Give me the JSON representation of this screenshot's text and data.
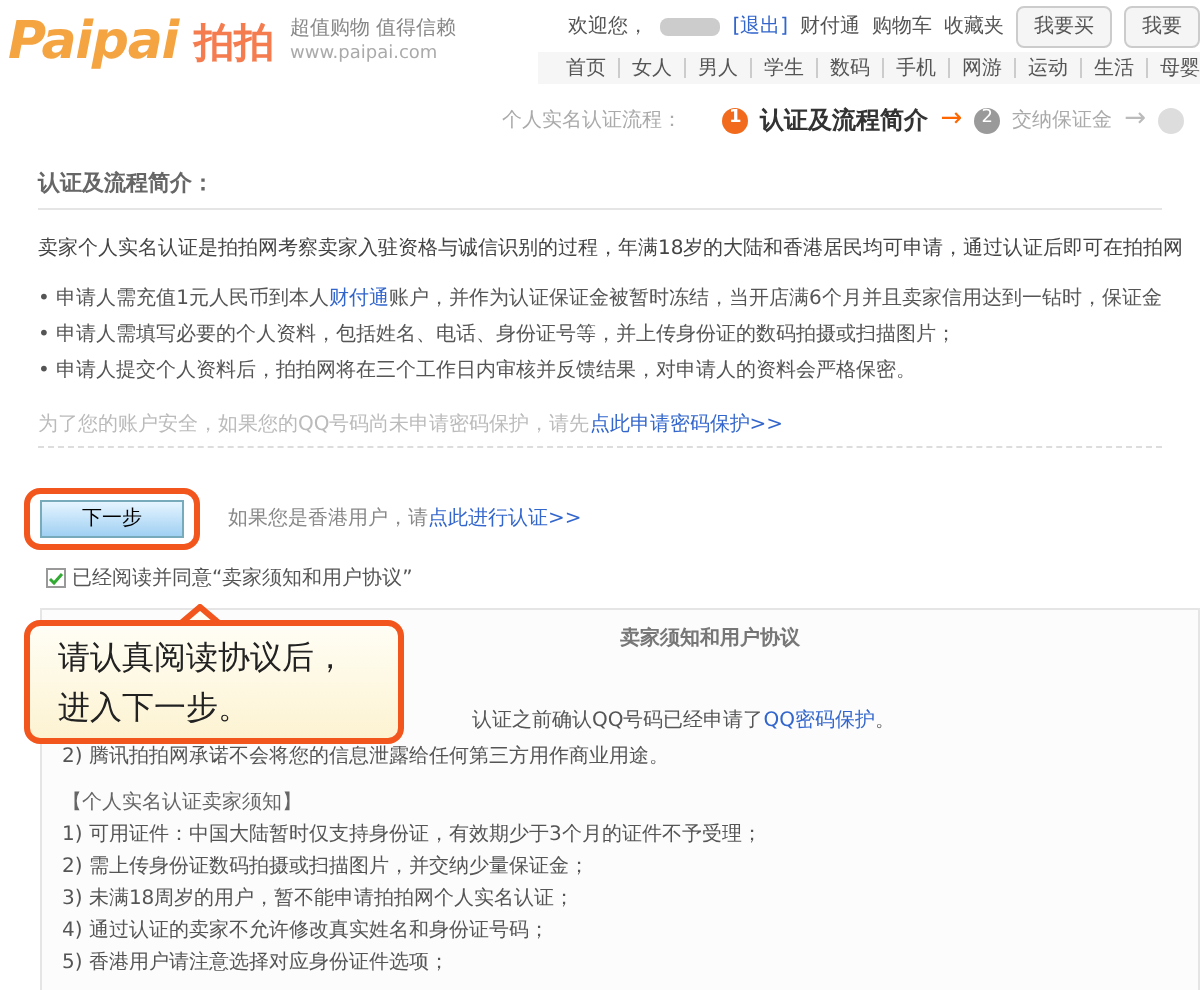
{
  "header": {
    "logo": "Paipai",
    "logo_cn": "拍拍",
    "slogan": "超值购物 值得信赖",
    "url": "www.paipai.com",
    "welcome": "欢迎您，",
    "logout": "[退出]",
    "links": [
      "财付通",
      "购物车",
      "收藏夹"
    ],
    "buttons": [
      "我要买",
      "我要"
    ]
  },
  "nav": [
    "首页",
    "女人",
    "男人",
    "学生",
    "数码",
    "手机",
    "网游",
    "运动",
    "生活",
    "母婴"
  ],
  "steps": {
    "label": "个人实名认证流程：",
    "items": [
      {
        "number": "1",
        "title": "认证及流程简介",
        "selected": true,
        "arrow": "→"
      },
      {
        "number": "2",
        "title": "交纳保证金",
        "selected": false,
        "arrow": "→"
      }
    ]
  },
  "section": {
    "title": "认证及流程简介：",
    "intro": "卖家个人实名认证是拍拍网考察卖家入驻资格与诚信识别的过程，年满18岁的大陆和香港居民均可申请，通过认证后即可在拍拍网",
    "bullets": [
      {
        "before": "• 申请人需充值1元人民币到本人",
        "link": "财付通",
        "after": "账户，并作为认证保证金被暂时冻结，当开店满6个月并且卖家信用达到一钻时，保证金"
      },
      {
        "before": "• 申请人需填写必要的个人资料，包括姓名、电话、身份证号等，并上传身份证的数码拍摄或扫描图片；"
      },
      {
        "before": "• 申请人提交个人资料后，拍拍网将在三个工作日内审核并反馈结果，对申请人的资料会严格保密。"
      }
    ],
    "security_note": "为了您的账户安全，如果您的QQ号码尚未申请密码保护，请先",
    "security_link": "点此申请密码保护>>"
  },
  "next_button": "下一步",
  "hk_note": "如果您是香港用户，请",
  "hk_link": "点此进行认证>>",
  "agree": {
    "checked": true,
    "label": "已经阅读并同意“卖家须知和用户协议”"
  },
  "callout": "请认真阅读协议后，进入下一步。",
  "agreement": {
    "title": "卖家须知和用户协议",
    "line1": "认证之前确认QQ号码已经申请了",
    "line1_link": "QQ密码保护",
    "line1_end": "。",
    "line2": "2) 腾讯拍拍网承诺不会将您的信息泄露给任何第三方用作商业用途。",
    "notice_title": "【个人实名认证卖家须知】",
    "notices": [
      "1) 可用证件：中国大陆暂时仅支持身份证，有效期少于3个月的证件不予受理；",
      "2) 需上传身份证数码拍摄或扫描图片，并交纳少量保证金；",
      "3) 未满18周岁的用户，暂不能申请拍拍网个人实名认证；",
      "4) 通过认证的卖家不允许修改真实姓名和身份证号码；",
      "5) 香港用户请注意选择对应身份证件选项；"
    ]
  }
}
